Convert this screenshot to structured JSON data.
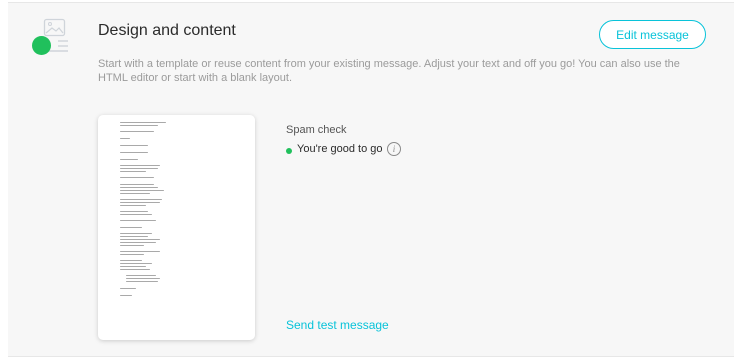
{
  "section": {
    "title": "Design and content",
    "description": "Start with a template or reuse content from your existing message. Adjust your text and off you go! You can also use the HTML editor or start with a blank layout.",
    "edit_button": "Edit message",
    "icon": "image-layout-icon"
  },
  "spam_check": {
    "title": "Spam check",
    "status": "You're good to go",
    "status_color": "#20c05c",
    "info_icon": "i"
  },
  "actions": {
    "send_test": "Send test message"
  },
  "colors": {
    "accent": "#09c3d9",
    "success": "#20c05c"
  }
}
